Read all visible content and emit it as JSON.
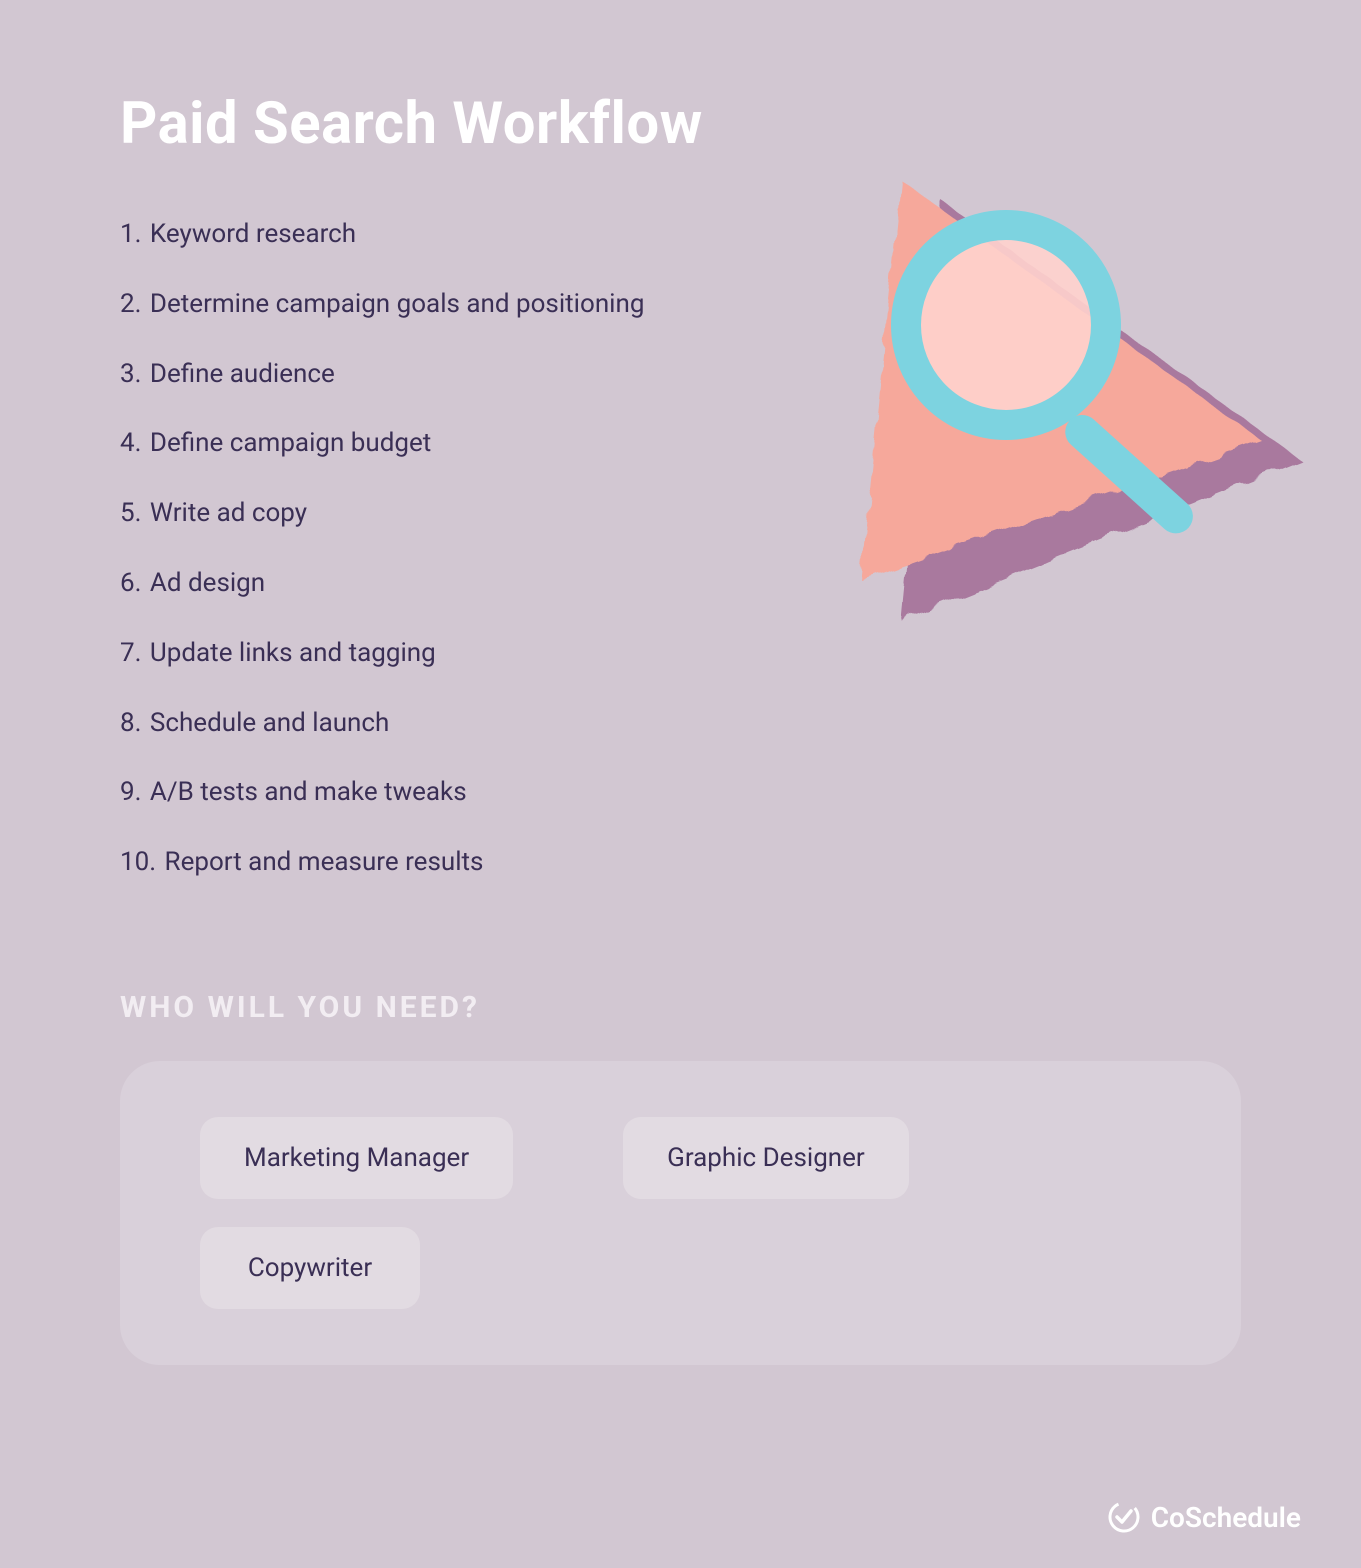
{
  "title": "Paid Search Workflow",
  "steps": [
    {
      "n": "1.",
      "text": "Keyword research"
    },
    {
      "n": "2.",
      "text": "Determine campaign goals and positioning"
    },
    {
      "n": "3.",
      "text": "Define audience"
    },
    {
      "n": "4.",
      "text": "Define campaign budget"
    },
    {
      "n": "5.",
      "text": "Write ad copy"
    },
    {
      "n": "6.",
      "text": "Ad design"
    },
    {
      "n": "7.",
      "text": "Update links and tagging"
    },
    {
      "n": "8.",
      "text": "Schedule and launch"
    },
    {
      "n": "9.",
      "text": "A/B tests and make tweaks"
    },
    {
      "n": "10.",
      "text": "Report and measure results"
    }
  ],
  "subheading": "WHO WILL YOU NEED?",
  "roles": [
    "Marketing Manager",
    "Graphic Designer",
    "Copywriter"
  ],
  "brand": "CoSchedule",
  "colors": {
    "bg": "#d2c7d2",
    "panel": "#d9d0da",
    "chip": "#e2dbe2",
    "text": "#3a2f55",
    "accentPink": "#f6a89b",
    "accentPurple": "#a7749c",
    "accentTeal": "#7dd3e0"
  }
}
